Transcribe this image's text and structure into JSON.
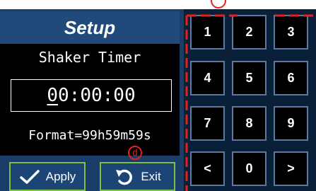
{
  "header": {
    "title": "Setup"
  },
  "timer": {
    "title": "Shaker Timer",
    "value_first": "0",
    "value_rest": "0:00:00",
    "format": "Format=99h59m59s"
  },
  "buttons": {
    "apply_label": "Apply",
    "exit_label": "Exit"
  },
  "keypad": {
    "keys": [
      "1",
      "2",
      "3",
      "4",
      "5",
      "6",
      "7",
      "8",
      "9",
      "<",
      "0",
      ">"
    ]
  },
  "annotations": {
    "marker_d": "d"
  },
  "colors": {
    "panel": "#1b3e68",
    "button_border": "#7dc143",
    "annotation_red": "#e8201c"
  }
}
